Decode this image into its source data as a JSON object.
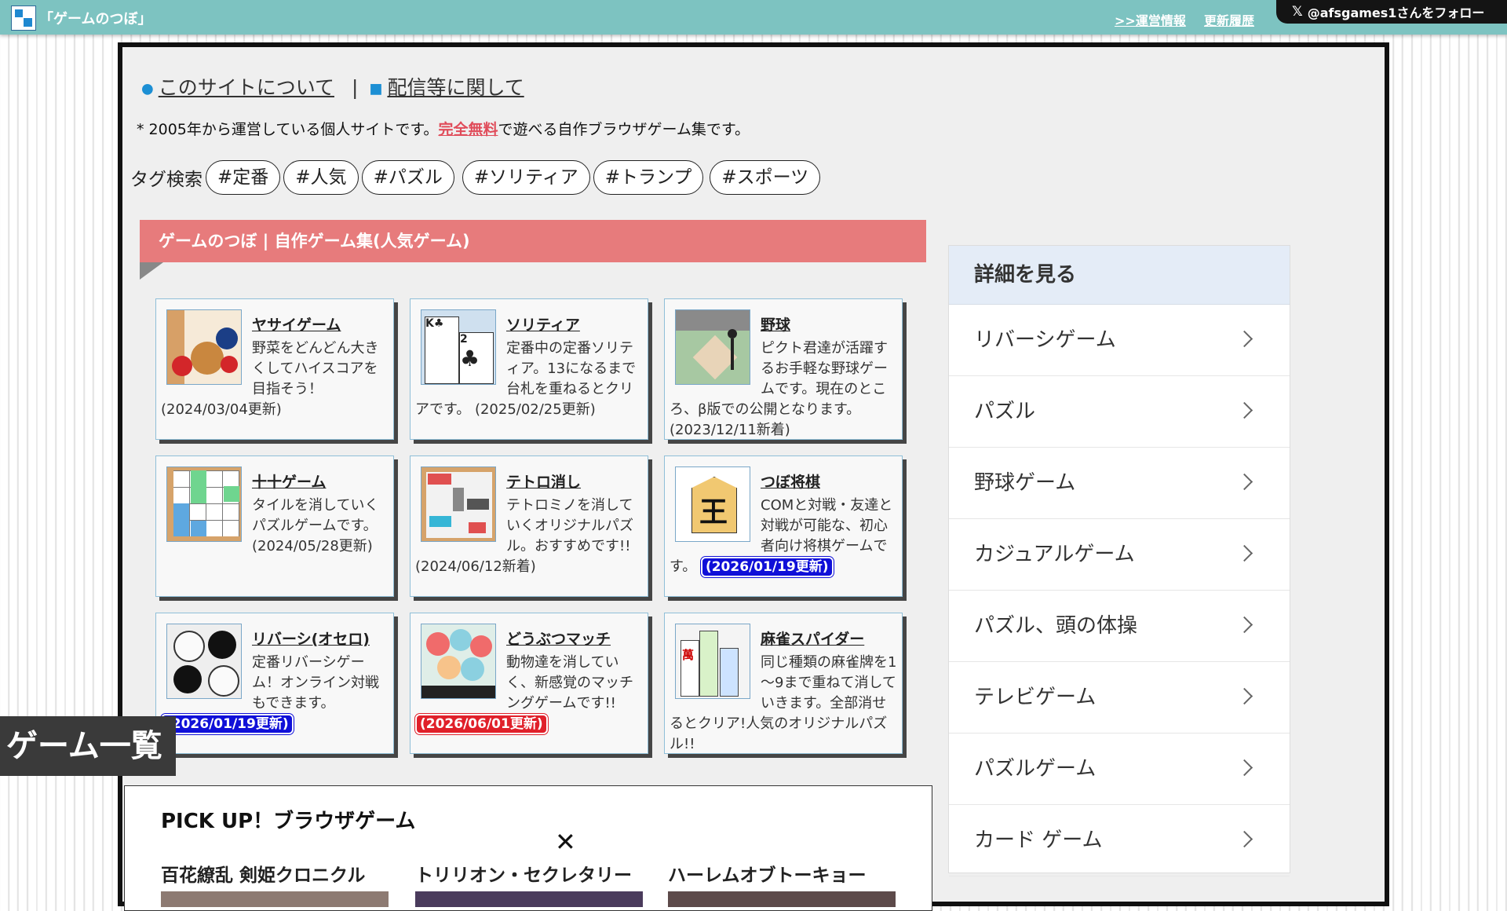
{
  "topbar": {
    "site_name": "「ゲームのつぼ」",
    "link_info": ">>運営情報",
    "link_history": "更新履歴",
    "follow": "@afsgames1さんをフォロー"
  },
  "nav": {
    "about": "このサイトについて",
    "separator": "|",
    "streaming": "配信等に関して"
  },
  "intro": {
    "before": "* 2005年から運営している個人サイトです。",
    "highlight": "完全無料",
    "after": "で遊べる自作ブラウザゲーム集です。"
  },
  "tags": {
    "label": "タグ検索",
    "items": [
      "#定番",
      "#人気",
      "#パズル",
      "#ソリティア",
      "#トランプ",
      "#スポーツ"
    ]
  },
  "section_title": "ゲームのつぼ | 自作ゲーム集(人気ゲーム)",
  "games": [
    {
      "title": "ヤサイゲーム",
      "desc": "野菜をどんどん大きくしてハイスコアを目指そう！",
      "date": "(2024/03/04更新)",
      "badge": ""
    },
    {
      "title": "ソリティア",
      "desc": "定番中の定番ソリティア。13になるまで台札を重ねるとクリアです。",
      "date": "(2025/02/25更新)",
      "badge": ""
    },
    {
      "title": "野球",
      "desc": "ピクト君達が活躍するお手軽な野球ゲームです。現在のところ、β版での公開となります。",
      "date": "(2023/12/11新着)",
      "badge": ""
    },
    {
      "title": "十十ゲーム",
      "desc": "タイルを消していくパズルゲームです。",
      "date": "(2024/05/28更新)",
      "badge": ""
    },
    {
      "title": "テトロ消し",
      "desc": "テトロミノを消していくオリジナルパズル。おすすめです!!",
      "date": "(2024/06/12新着)",
      "badge": ""
    },
    {
      "title": "つぼ将棋",
      "desc": "COMと対戦・友達と対戦が可能な、初心者向け将棋ゲームです。",
      "date": "",
      "badge": "(2026/01/19更新)"
    },
    {
      "title": "リバーシ(オセロ)",
      "desc": "定番リバーシゲーム！オンライン対戦もできます。",
      "date": "",
      "badge": "(2026/01/19更新)"
    },
    {
      "title": "どうぶつマッチ",
      "desc": "動物達を消していく、新感覚のマッチングゲームです!!",
      "date": "",
      "badge": "(2026/06/01更新)"
    },
    {
      "title": "麻雀スパイダー",
      "desc": "同じ種類の麻雀牌を1～9まで重ねて消していきます。全部消せるとクリア!人気のオリジナルパズル!!",
      "date": "",
      "badge": ""
    }
  ],
  "game_list_tab": "ゲーム一覧",
  "pickup": {
    "title": "PICK UP！ブラウザゲーム",
    "close": "✕",
    "items": [
      "百花繚乱 剣姫クロニクル",
      "トリリオン・セクレタリー",
      "ハーレムオブトーキョー"
    ]
  },
  "sidebar": {
    "header": "詳細を見る",
    "items": [
      "リバーシゲーム",
      "パズル",
      "野球ゲーム",
      "カジュアルゲーム",
      "パズル、頭の体操",
      "テレビゲーム",
      "パズルゲーム",
      "カード ゲーム"
    ]
  },
  "colors": {
    "topbar": "#7dc3c1",
    "section_header": "#e77b7c",
    "badge_blue": "#1010d8",
    "badge_red": "#e0202a",
    "free_text": "#e04c5a"
  }
}
